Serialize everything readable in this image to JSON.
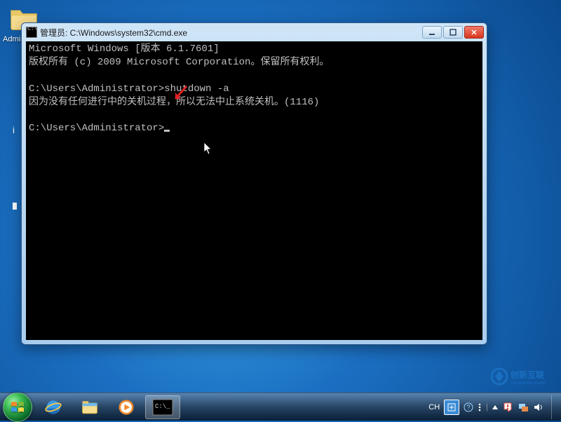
{
  "desktop": {
    "icon1_label": "Administra...",
    "icon2_label": " "
  },
  "window": {
    "title": "管理员: C:\\Windows\\system32\\cmd.exe"
  },
  "terminal": {
    "line1": "Microsoft Windows [版本 6.1.7601]",
    "line2": "版权所有 (c) 2009 Microsoft Corporation。保留所有权利。",
    "blank": "",
    "prompt1_prefix": "C:\\Users\\Administrator>",
    "cmd1": "shutdown -a",
    "msg1": "因为没有任何进行中的关机过程，所以无法中止系统关机。(1116)",
    "prompt2": "C:\\Users\\Administrator>"
  },
  "taskbar": {
    "ime_text": "CH"
  },
  "watermark": {
    "brand": "创新互联"
  }
}
